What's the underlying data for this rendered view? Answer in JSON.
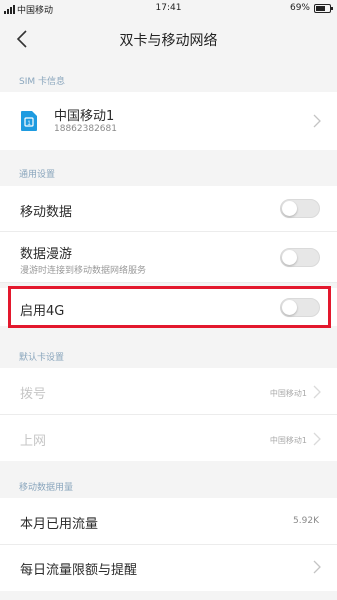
{
  "status_bar": {
    "carrier": "中国移动",
    "time": "17:41",
    "battery": "69%",
    "battery_level": 0.69
  },
  "header": {
    "title": "双卡与移动网络"
  },
  "sim_section": {
    "label": "SIM 卡信息",
    "sim_name": "中国移动1",
    "sim_number": "18862382681"
  },
  "general_section": {
    "label": "通用设置",
    "mobile_data": {
      "label": "移动数据",
      "enabled": false
    },
    "data_roaming": {
      "label": "数据漫游",
      "sublabel": "漫游时连接到移动数据网络服务",
      "enabled": false
    },
    "enable_4g": {
      "label": "启用4G",
      "enabled": false
    }
  },
  "default_section": {
    "label": "默认卡设置",
    "dial": {
      "label": "拨号",
      "value": "中国移动1"
    },
    "internet": {
      "label": "上网",
      "value": "中国移动1"
    }
  },
  "usage_section": {
    "label": "移动数据用量",
    "monthly_usage": {
      "label": "本月已用流量",
      "value": "5.92K"
    },
    "daily_limit": {
      "label": "每日流量限额与提醒"
    }
  },
  "colors": {
    "accent_label": "#8aa6bd",
    "highlight": "#e3182d",
    "sim_icon": "#1e9be0"
  }
}
